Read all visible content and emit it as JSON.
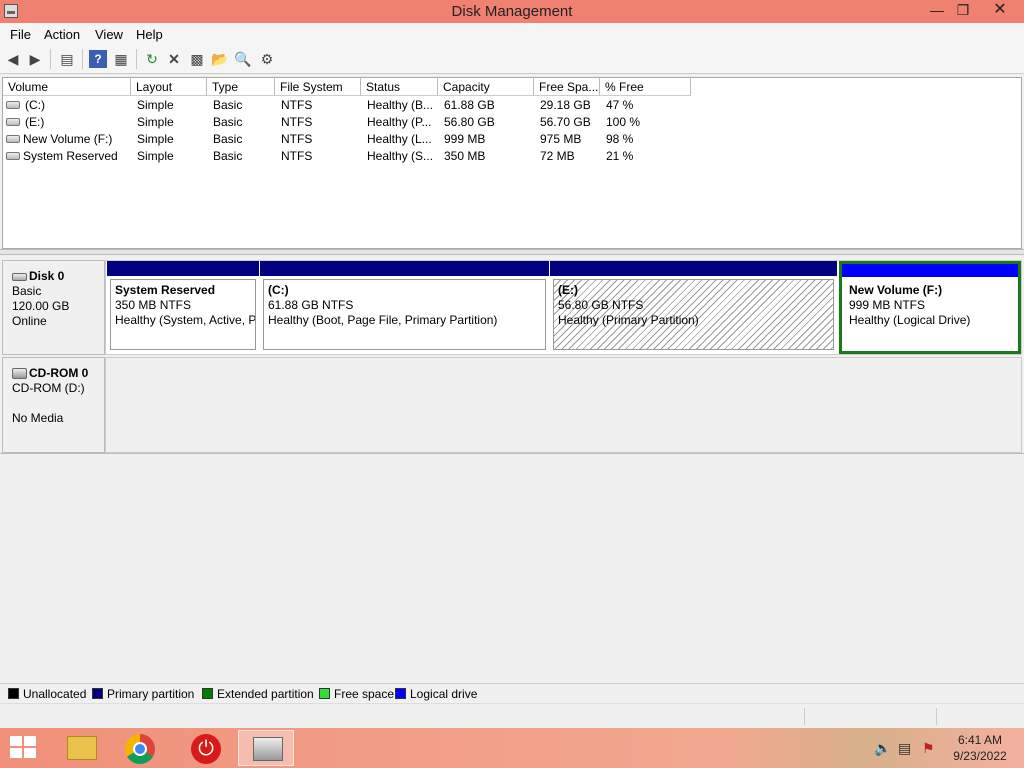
{
  "window": {
    "title": "Disk Management",
    "min_glyph": "—",
    "max_glyph": "❐",
    "close_glyph": "✕"
  },
  "menu": [
    "File",
    "Action",
    "View",
    "Help"
  ],
  "volume_table": {
    "columns": [
      "Volume",
      "Layout",
      "Type",
      "File System",
      "Status",
      "Capacity",
      "Free Spa...",
      "% Free"
    ],
    "rows": [
      [
        "(C:)",
        "Simple",
        "Basic",
        "NTFS",
        "Healthy (B...",
        "61.88 GB",
        "29.18 GB",
        "47 %"
      ],
      [
        "(E:)",
        "Simple",
        "Basic",
        "NTFS",
        "Healthy (P...",
        "56.80 GB",
        "56.70 GB",
        "100 %"
      ],
      [
        "New Volume (F:)",
        "Simple",
        "Basic",
        "NTFS",
        "Healthy (L...",
        "999 MB",
        "975 MB",
        "98 %"
      ],
      [
        "System Reserved",
        "Simple",
        "Basic",
        "NTFS",
        "Healthy (S...",
        "350 MB",
        "72 MB",
        "21 %"
      ]
    ]
  },
  "disks": {
    "disk0": {
      "name": "Disk 0",
      "type": "Basic",
      "size": "120.00 GB",
      "state": "Online",
      "partitions": [
        {
          "name": "System Reserved",
          "size": "350 MB NTFS",
          "status": "Healthy (System, Active, P"
        },
        {
          "name": "(C:)",
          "size": "61.88 GB NTFS",
          "status": "Healthy (Boot, Page File, Primary Partition)"
        },
        {
          "name": "(E:)",
          "size": "56.80 GB NTFS",
          "status": "Healthy (Primary Partition)"
        },
        {
          "name": "New Volume  (F:)",
          "size": "999 MB NTFS",
          "status": "Healthy (Logical Drive)"
        }
      ]
    },
    "cdrom0": {
      "name": "CD-ROM 0",
      "drive": "CD-ROM (D:)",
      "media": "No Media"
    }
  },
  "legend": [
    {
      "label": "Unallocated",
      "color": "#000000"
    },
    {
      "label": "Primary partition",
      "color": "#000080"
    },
    {
      "label": "Extended partition",
      "color": "#008000"
    },
    {
      "label": "Free space",
      "color": "#33dd33"
    },
    {
      "label": "Logical drive",
      "color": "#0000ff"
    }
  ],
  "taskbar": {
    "time": "6:41 AM",
    "date": "9/23/2022"
  }
}
